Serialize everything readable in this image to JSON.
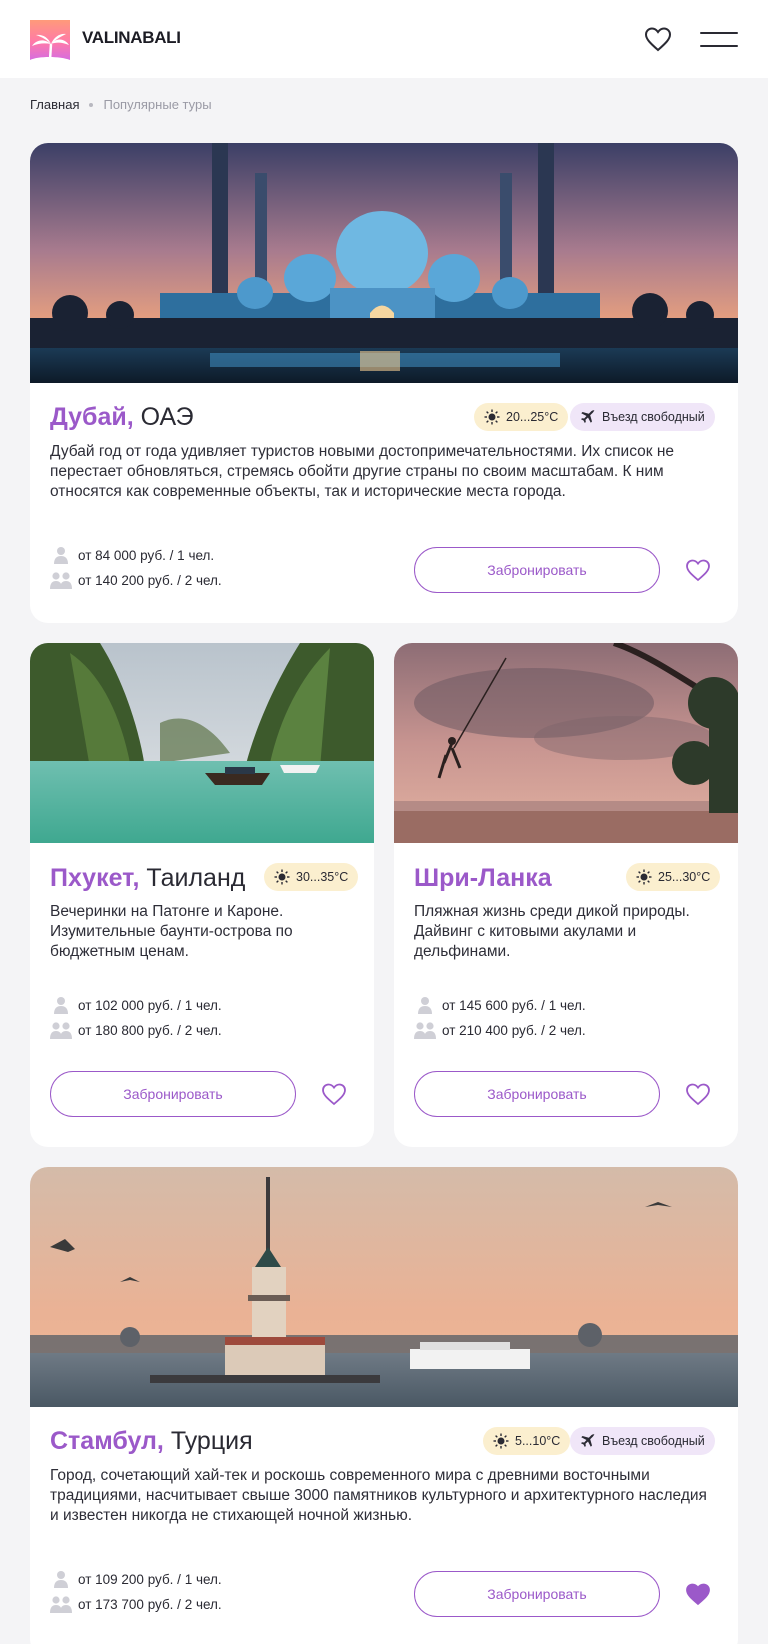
{
  "header": {
    "brand": "VALINABALI"
  },
  "breadcrumb": {
    "home": "Главная",
    "current": "Популярные туры"
  },
  "tours": [
    {
      "city": "Дубай,",
      "country": " ОАЭ",
      "temp": "20...25°C",
      "entry": "Въезд свободный",
      "description": "Дубай год от года удивляет туристов новыми достопримечательностями. Их список не перестает обновляться, стремясь обойти другие страны по своим масштабам. К ним относятся как современные объекты, так и исторические места города.",
      "price_one": "от 84 000 руб. / 1 чел.",
      "price_two": "от 140 200 руб. / 2 чел.",
      "book_label": "Забронировать",
      "favorited": false
    },
    {
      "city": "Пхукет,",
      "country": " Таиланд",
      "temp": "30...35°C",
      "description": "Вечеринки на Патонге и Кароне. Изумительные баунти-острова по бюджетным ценам.",
      "price_one": "от 102 000 руб. / 1 чел.",
      "price_two": "от 180 800 руб. / 2 чел.",
      "book_label": "Забронировать",
      "favorited": false
    },
    {
      "city": "Шри-Ланка",
      "country": "",
      "temp": "25...30°C",
      "description": "Пляжная жизнь среди дикой природы. Дайвинг с китовыми акулами и дельфинами.",
      "price_one": "от 145 600 руб. / 1 чел.",
      "price_two": "от 210 400 руб. / 2 чел.",
      "book_label": "Забронировать",
      "favorited": false
    },
    {
      "city": "Стамбул,",
      "country": " Турция",
      "temp": "5...10°C",
      "entry": "Въезд свободный",
      "description": "Город, сочетающий хай-тек и роскошь современного мира с древними восточными традициями, насчитывает свыше 3000 памятников культурного и архитектурного наследия и известен никогда не стихающей ночной жизнью.",
      "price_one": "от 109 200 руб. / 1 чел.",
      "price_two": "от 173 700 руб. / 2 чел.",
      "book_label": "Забронировать",
      "favorited": true
    }
  ],
  "colors": {
    "accent": "#9b59c9",
    "temp_badge": "#fbefcf",
    "entry_badge": "#f0e6f8",
    "background": "#f4f4f6"
  },
  "icons": [
    "heart-icon",
    "menu-icon",
    "sun-icon",
    "plane-icon",
    "person-icon",
    "two-persons-icon"
  ]
}
